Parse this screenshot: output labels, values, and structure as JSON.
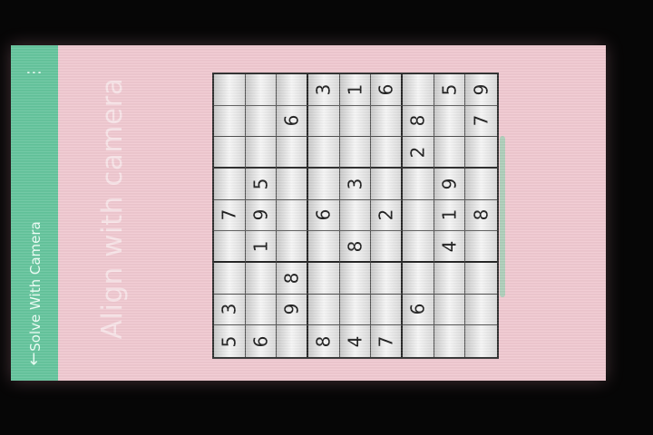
{
  "app_bar": {
    "title": "Solve With Camera",
    "back_icon": "back-arrow-icon",
    "menu_icon": "overflow-menu-icon",
    "color": "#63c49c"
  },
  "instruction": "Align with camera",
  "colors": {
    "screen_background": "#f0c8d0",
    "scan_frame": "#76d4a6"
  },
  "sudoku": {
    "rows": [
      [
        "5",
        "3",
        "",
        "",
        "7",
        "",
        "",
        "",
        ""
      ],
      [
        "6",
        "",
        "",
        "1",
        "9",
        "5",
        "",
        "",
        ""
      ],
      [
        "",
        "9",
        "8",
        "",
        "",
        "",
        "",
        "6",
        ""
      ],
      [
        "8",
        "",
        "",
        "",
        "6",
        "",
        "",
        "",
        "3"
      ],
      [
        "4",
        "",
        "",
        "8",
        "",
        "3",
        "",
        "",
        "1"
      ],
      [
        "7",
        "",
        "",
        "",
        "2",
        "",
        "",
        "",
        "6"
      ],
      [
        "",
        "6",
        "",
        "",
        "",
        "",
        "2",
        "8",
        ""
      ],
      [
        "",
        "",
        "",
        "4",
        "1",
        "9",
        "",
        "",
        "5"
      ],
      [
        "",
        "",
        "",
        "",
        "8",
        "",
        "",
        "7",
        "9"
      ]
    ]
  }
}
